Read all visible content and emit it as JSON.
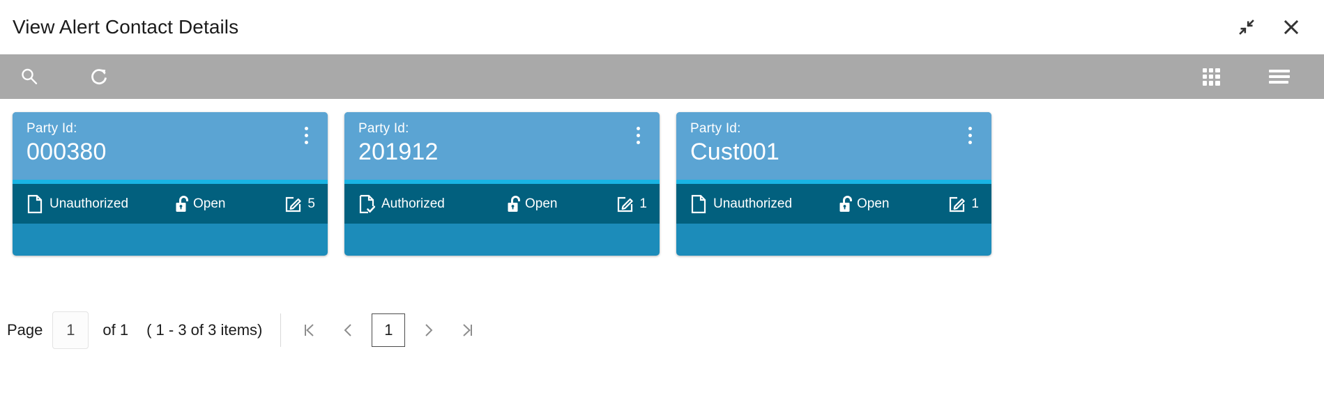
{
  "window": {
    "title": "View Alert Contact Details",
    "minimize_icon": "collapse-arrows-icon",
    "close_icon": "close-icon"
  },
  "toolbar": {
    "background": "#a9a9a9",
    "search_icon": "search-icon",
    "refresh_icon": "refresh-icon",
    "grid_view_icon": "grid-view-icon",
    "list_view_icon": "list-view-icon"
  },
  "cards": {
    "field_label": "Party Id:",
    "header_color": "#5ba4d3",
    "accent_color": "#19b4e3",
    "footer_color": "#02607e",
    "body_color": "#1c8cba",
    "items": [
      {
        "label": "Party Id:",
        "value": "000380",
        "auth_status": "Unauthorized",
        "auth_icon": "document-icon",
        "lock_status": "Open",
        "lock_icon": "unlock-icon",
        "edit_icon": "edit-icon",
        "edit_count": "5",
        "menu_icon": "kebab-menu-icon"
      },
      {
        "label": "Party Id:",
        "value": "201912",
        "auth_status": "Authorized",
        "auth_icon": "document-check-icon",
        "lock_status": "Open",
        "lock_icon": "unlock-icon",
        "edit_icon": "edit-icon",
        "edit_count": "1",
        "menu_icon": "kebab-menu-icon"
      },
      {
        "label": "Party Id:",
        "value": "Cust001",
        "auth_status": "Unauthorized",
        "auth_icon": "document-icon",
        "lock_status": "Open",
        "lock_icon": "unlock-icon",
        "edit_icon": "edit-icon",
        "edit_count": "1",
        "menu_icon": "kebab-menu-icon"
      }
    ]
  },
  "pagination": {
    "page_label": "Page",
    "page_value": "1",
    "of_text": "of 1",
    "items_text": "( 1 - 3 of 3 items)",
    "first_icon": "first-page-icon",
    "prev_icon": "previous-page-icon",
    "current_page": "1",
    "next_icon": "next-page-icon",
    "last_icon": "last-page-icon"
  }
}
